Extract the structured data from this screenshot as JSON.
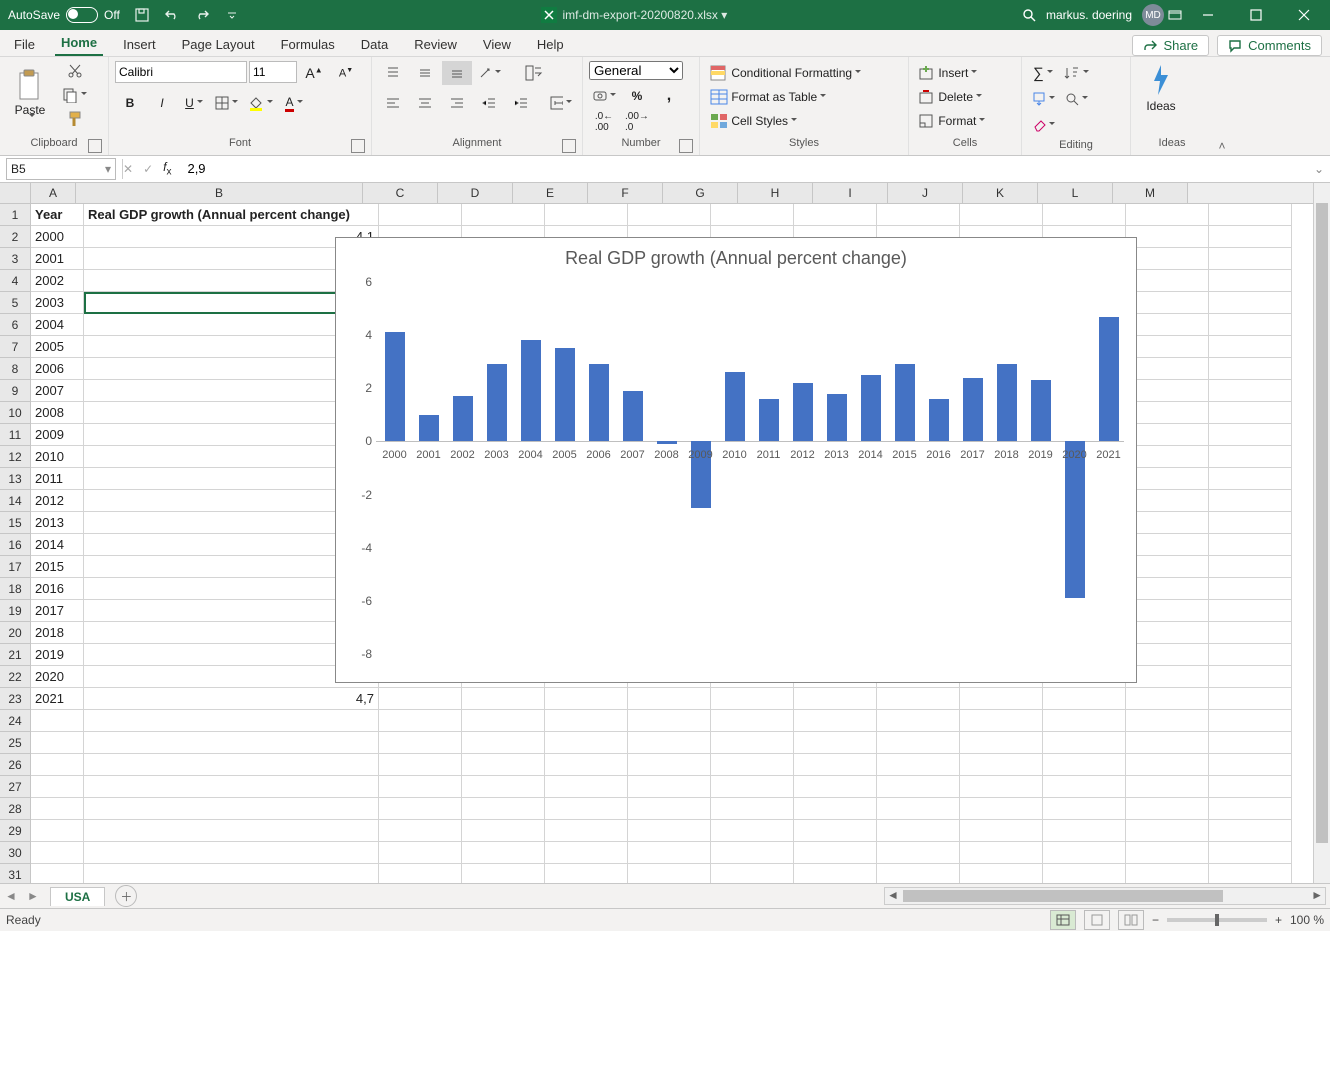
{
  "titlebar": {
    "autosave_label": "AutoSave",
    "autosave_state": "Off",
    "filename": "imf-dm-export-20200820.xlsx ▾",
    "user": "markus. doering",
    "initials": "MD"
  },
  "tabs": [
    "File",
    "Home",
    "Insert",
    "Page Layout",
    "Formulas",
    "Data",
    "Review",
    "View",
    "Help"
  ],
  "active_tab": "Home",
  "share": "Share",
  "comments": "Comments",
  "ribbon": {
    "clipboard": "Clipboard",
    "paste": "Paste",
    "font": "Font",
    "font_name": "Calibri",
    "font_size": "11",
    "alignment": "Alignment",
    "number": "Number",
    "number_format": "General",
    "styles": "Styles",
    "cond_fmt": "Conditional Formatting",
    "fmt_table": "Format as Table",
    "cell_styles": "Cell Styles",
    "cells": "Cells",
    "insert": "Insert",
    "delete": "Delete",
    "format": "Format",
    "editing": "Editing",
    "ideas": "Ideas"
  },
  "formula": {
    "cell_ref": "B5",
    "value": "2,9"
  },
  "columns": [
    "A",
    "B",
    "C",
    "D",
    "E",
    "F",
    "G",
    "H",
    "I",
    "J",
    "K",
    "L",
    "M"
  ],
  "cells": {
    "A1": "Year",
    "B1": "Real GDP growth (Annual percent change)",
    "A": [
      "2000",
      "2001",
      "2002",
      "2003",
      "2004",
      "2005",
      "2006",
      "2007",
      "2008",
      "2009",
      "2010",
      "2011",
      "2012",
      "2013",
      "2014",
      "2015",
      "2016",
      "2017",
      "2018",
      "2019",
      "2020",
      "2021"
    ],
    "B2": "4,1",
    "B23": "4,7"
  },
  "chart_data": {
    "type": "bar",
    "title": "Real GDP growth (Annual percent change)",
    "categories": [
      "2000",
      "2001",
      "2002",
      "2003",
      "2004",
      "2005",
      "2006",
      "2007",
      "2008",
      "2009",
      "2010",
      "2011",
      "2012",
      "2013",
      "2014",
      "2015",
      "2016",
      "2017",
      "2018",
      "2019",
      "2020",
      "2021"
    ],
    "values": [
      4.1,
      1.0,
      1.7,
      2.9,
      3.8,
      3.5,
      2.9,
      1.9,
      -0.1,
      -2.5,
      2.6,
      1.6,
      2.2,
      1.8,
      2.5,
      2.9,
      1.6,
      2.4,
      2.9,
      2.3,
      -5.9,
      4.7
    ],
    "ylim": [
      -8,
      6
    ],
    "yticks": [
      -8,
      -6,
      -4,
      -2,
      0,
      2,
      4,
      6
    ],
    "xlabel": "",
    "ylabel": ""
  },
  "sheet_tab": "USA",
  "status": {
    "ready": "Ready",
    "zoom": "100 %"
  }
}
